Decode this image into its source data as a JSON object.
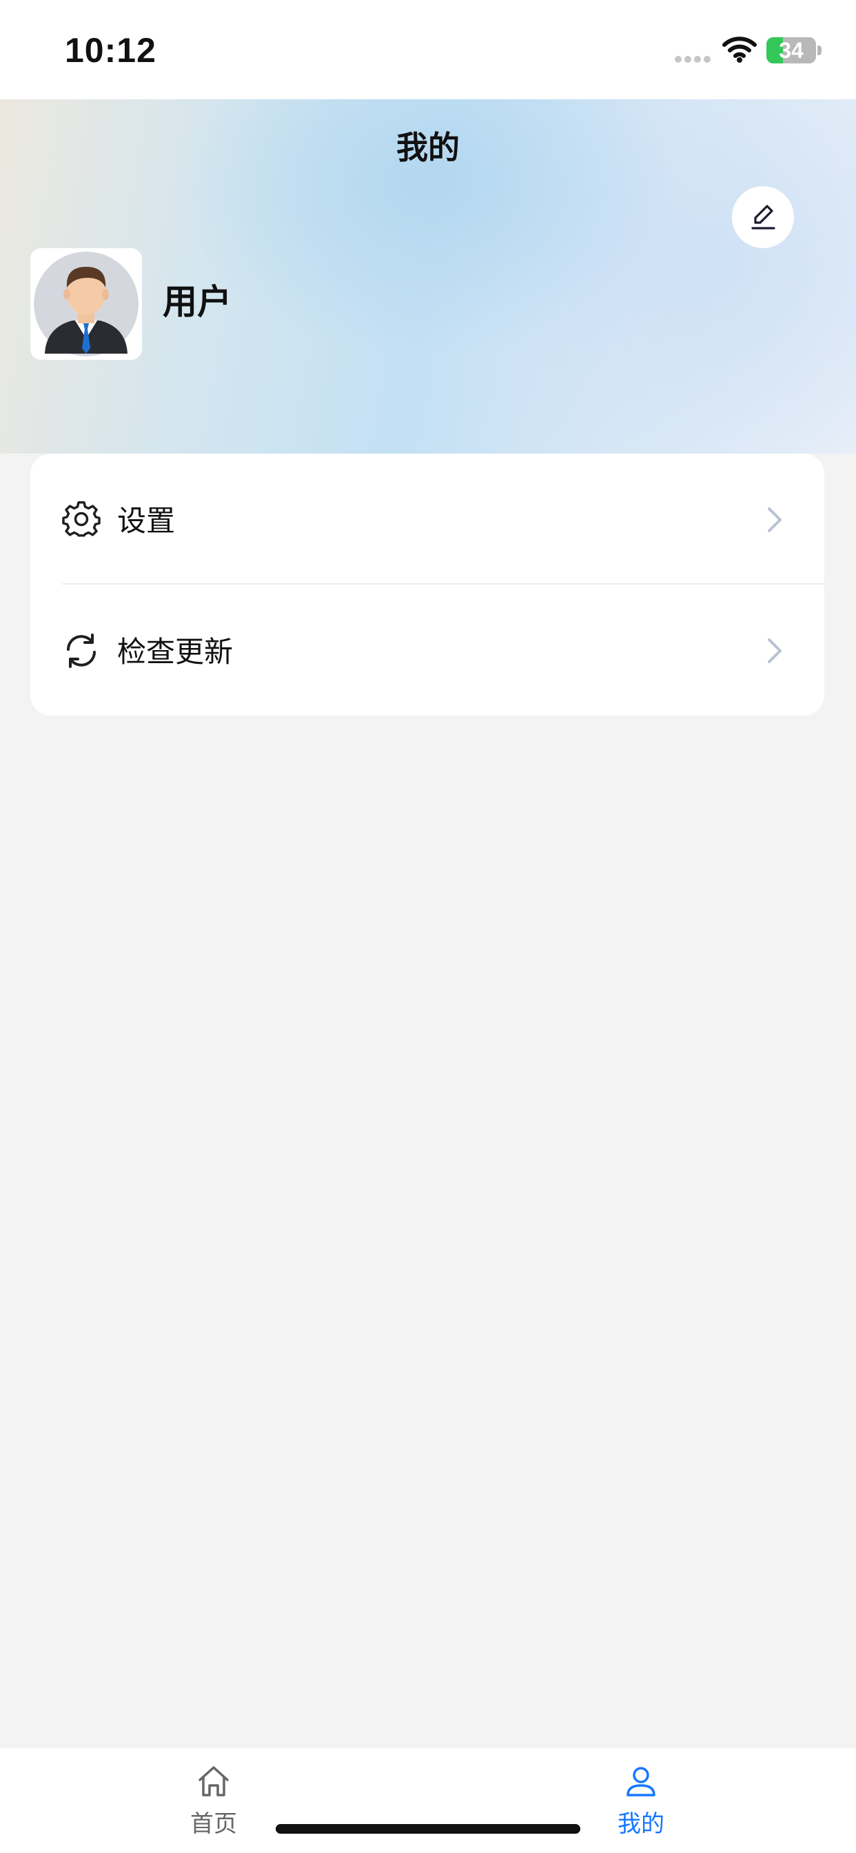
{
  "status_bar": {
    "time": "10:12",
    "battery_level": "34",
    "battery_fraction": 0.34,
    "battery_color": "#34c759"
  },
  "header": {
    "title": "我的",
    "edit_icon": "pencil-edit-icon",
    "user": {
      "name": "用户",
      "avatar": "businessman-avatar"
    }
  },
  "menu": {
    "items": [
      {
        "label": "设置",
        "icon": "gear-icon"
      },
      {
        "label": "检查更新",
        "icon": "refresh-icon"
      }
    ]
  },
  "tab_bar": {
    "tabs": [
      {
        "label": "首页",
        "icon": "home-icon",
        "active": false
      },
      {
        "label": "我的",
        "icon": "person-icon",
        "active": true
      }
    ],
    "active_color": "#1677ff",
    "inactive_color": "#666666"
  }
}
